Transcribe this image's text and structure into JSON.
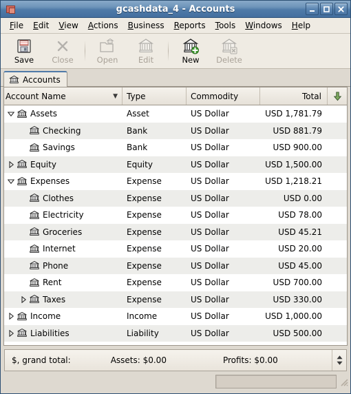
{
  "window": {
    "title": "gcashdata_4 - Accounts",
    "icon": "app-icon",
    "buttons": [
      {
        "name": "minimize",
        "glyph": "minimize-icon"
      },
      {
        "name": "maximize",
        "glyph": "maximize-icon"
      },
      {
        "name": "close",
        "glyph": "close-icon"
      }
    ]
  },
  "menubar": {
    "items": [
      {
        "label": "File",
        "accel": "F"
      },
      {
        "label": "Edit",
        "accel": "E"
      },
      {
        "label": "View",
        "accel": "V"
      },
      {
        "label": "Actions",
        "accel": "A"
      },
      {
        "label": "Business",
        "accel": "B"
      },
      {
        "label": "Reports",
        "accel": "R"
      },
      {
        "label": "Tools",
        "accel": "T"
      },
      {
        "label": "Windows",
        "accel": "W"
      },
      {
        "label": "Help",
        "accel": "H"
      }
    ]
  },
  "toolbar": {
    "buttons": [
      {
        "label": "Save",
        "icon": "save-floppy-icon",
        "enabled": true
      },
      {
        "label": "Close",
        "icon": "close-x-icon",
        "enabled": false
      },
      {
        "label": "Open",
        "icon": "open-folder-icon",
        "enabled": false
      },
      {
        "label": "Edit",
        "icon": "edit-account-icon",
        "enabled": false
      },
      {
        "label": "New",
        "icon": "new-account-icon",
        "enabled": true
      },
      {
        "label": "Delete",
        "icon": "delete-account-icon",
        "enabled": false
      }
    ]
  },
  "tabs": [
    {
      "label": "Accounts",
      "icon": "accounts-tab-icon",
      "active": true
    }
  ],
  "table": {
    "columns": [
      {
        "key": "name",
        "label": "Account Name",
        "sorted": true
      },
      {
        "key": "type",
        "label": "Type"
      },
      {
        "key": "commodity",
        "label": "Commodity"
      },
      {
        "key": "total",
        "label": "Total"
      }
    ],
    "options_icon": "column-options-arrow-icon",
    "rows": [
      {
        "name": "Assets",
        "type": "Asset",
        "commodity": "US Dollar",
        "total": "USD 1,781.79",
        "depth": 0,
        "expander": "expanded"
      },
      {
        "name": "Checking",
        "type": "Bank",
        "commodity": "US Dollar",
        "total": "USD 881.79",
        "depth": 1,
        "expander": "none"
      },
      {
        "name": "Savings",
        "type": "Bank",
        "commodity": "US Dollar",
        "total": "USD 900.00",
        "depth": 1,
        "expander": "none"
      },
      {
        "name": "Equity",
        "type": "Equity",
        "commodity": "US Dollar",
        "total": "USD 1,500.00",
        "depth": 0,
        "expander": "collapsed"
      },
      {
        "name": "Expenses",
        "type": "Expense",
        "commodity": "US Dollar",
        "total": "USD 1,218.21",
        "depth": 0,
        "expander": "expanded"
      },
      {
        "name": "Clothes",
        "type": "Expense",
        "commodity": "US Dollar",
        "total": "USD 0.00",
        "depth": 1,
        "expander": "none"
      },
      {
        "name": "Electricity",
        "type": "Expense",
        "commodity": "US Dollar",
        "total": "USD 78.00",
        "depth": 1,
        "expander": "none"
      },
      {
        "name": "Groceries",
        "type": "Expense",
        "commodity": "US Dollar",
        "total": "USD 45.21",
        "depth": 1,
        "expander": "none"
      },
      {
        "name": "Internet",
        "type": "Expense",
        "commodity": "US Dollar",
        "total": "USD 20.00",
        "depth": 1,
        "expander": "none"
      },
      {
        "name": "Phone",
        "type": "Expense",
        "commodity": "US Dollar",
        "total": "USD 45.00",
        "depth": 1,
        "expander": "none"
      },
      {
        "name": "Rent",
        "type": "Expense",
        "commodity": "US Dollar",
        "total": "USD 700.00",
        "depth": 1,
        "expander": "none"
      },
      {
        "name": "Taxes",
        "type": "Expense",
        "commodity": "US Dollar",
        "total": "USD 330.00",
        "depth": 1,
        "expander": "collapsed"
      },
      {
        "name": "Income",
        "type": "Income",
        "commodity": "US Dollar",
        "total": "USD 1,000.00",
        "depth": 0,
        "expander": "collapsed"
      },
      {
        "name": "Liabilities",
        "type": "Liability",
        "commodity": "US Dollar",
        "total": "USD 500.00",
        "depth": 0,
        "expander": "collapsed"
      }
    ]
  },
  "summary": {
    "grand_total_label": "$, grand total:",
    "assets": "Assets: $0.00",
    "profits": "Profits: $0.00",
    "spinner_icon": "updown-spinner-icon"
  },
  "statusbar": {
    "progress_value": "",
    "grip_icon": "resize-grip-icon"
  },
  "colors": {
    "titlebar_top": "#88a9c9",
    "titlebar_bottom": "#436f9f",
    "chrome": "#efebe3",
    "window_bg": "#ded9d0",
    "row_alt": "#ededea",
    "accent_green": "#6f9e52"
  }
}
